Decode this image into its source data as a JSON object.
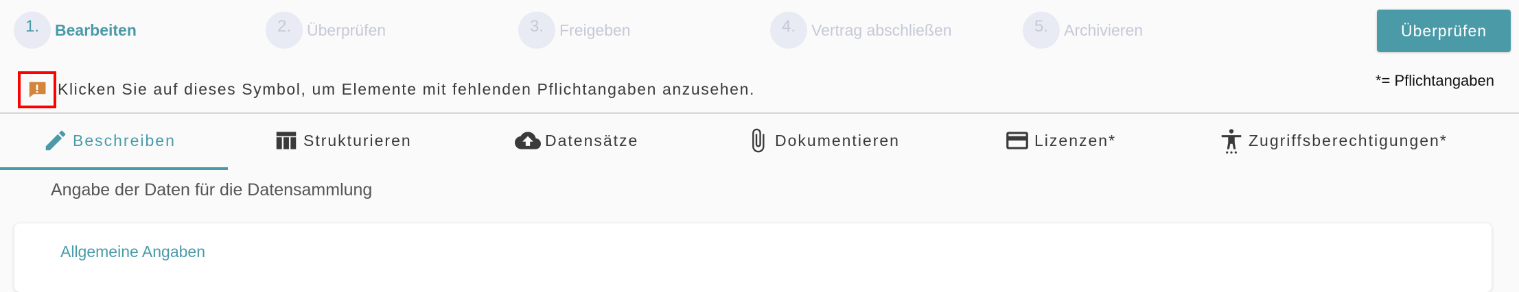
{
  "stepper": {
    "steps": [
      {
        "number": "1.",
        "label": "Bearbeiten",
        "active": true
      },
      {
        "number": "2.",
        "label": "Überprüfen",
        "active": false
      },
      {
        "number": "3.",
        "label": "Freigeben",
        "active": false
      },
      {
        "number": "4.",
        "label": "Vertrag abschließen",
        "active": false
      },
      {
        "number": "5.",
        "label": "Archivieren",
        "active": false
      }
    ]
  },
  "header": {
    "review_button": "Überprüfen"
  },
  "hint": {
    "icon": "comment-alert-icon",
    "icon_color": "#d2863d",
    "text": "Klicken Sie auf dieses Symbol, um Elemente mit fehlenden Pflichtangaben anzusehen.",
    "required_note": "*= Pflichtangaben"
  },
  "tabs": [
    {
      "label": "Beschreiben",
      "icon": "pencil-icon",
      "active": true
    },
    {
      "label": "Strukturieren",
      "icon": "table-icon",
      "active": false
    },
    {
      "label": "Datensätze",
      "icon": "cloud-upload-icon",
      "active": false
    },
    {
      "label": "Dokumentieren",
      "icon": "paperclip-icon",
      "active": false
    },
    {
      "label": "Lizenzen*",
      "icon": "credit-card-icon",
      "active": false
    },
    {
      "label": "Zugriffsberechtigungen*",
      "icon": "accessibility-icon",
      "active": false
    }
  ],
  "main": {
    "description": "Angabe der Daten für die Datensammlung",
    "card_title": "Allgemeine Angaben"
  },
  "colors": {
    "accent": "#4a9aa8",
    "inactive_step": "#c6c9d8",
    "highlight_border": "#ff0000"
  }
}
